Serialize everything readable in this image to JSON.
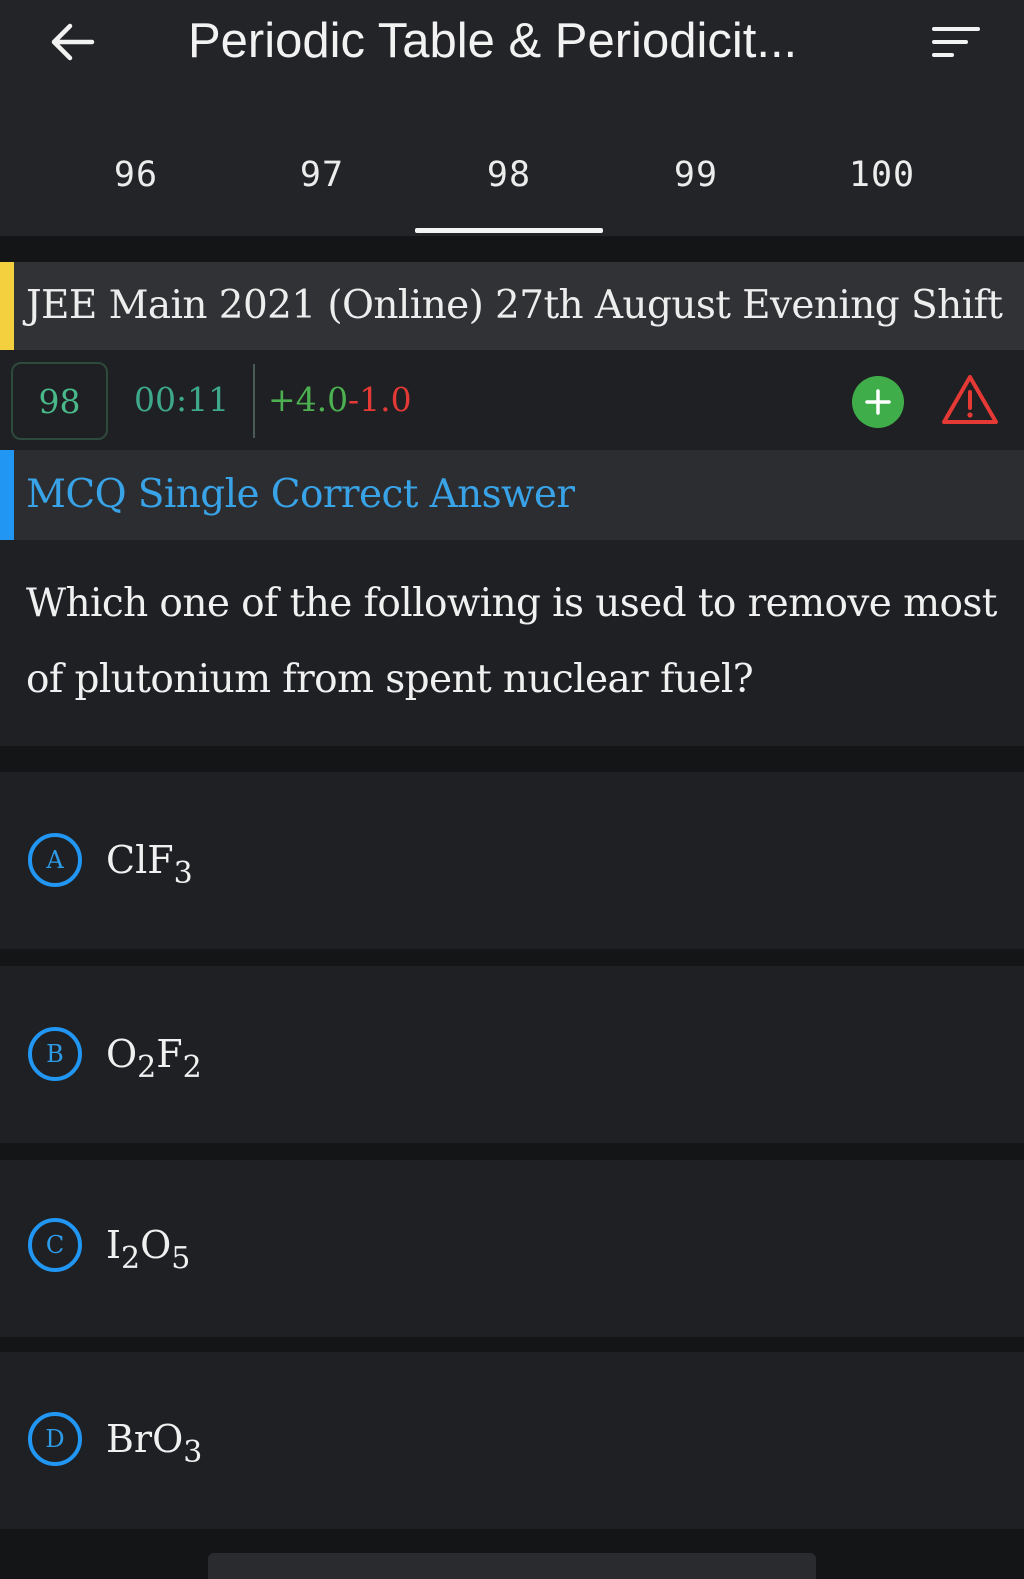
{
  "header": {
    "title": "Periodic Table & Periodicit...",
    "back_icon": "arrow-left-icon",
    "filter_icon": "filter-lines-icon"
  },
  "question_tabs": [
    {
      "label": "96"
    },
    {
      "label": "97"
    },
    {
      "label": "98",
      "active": true
    },
    {
      "label": "99"
    },
    {
      "label": "100"
    }
  ],
  "exam": {
    "label": "JEE Main 2021 (Online) 27th August Evening Shift",
    "accent_color": "#f4d03f"
  },
  "meta": {
    "question_number": "98",
    "timer": "00:11",
    "positive_marks": "+4.0",
    "negative_marks": "-1.0",
    "add_icon": "plus-circle-icon",
    "report_icon": "warning-triangle-icon"
  },
  "question_type": {
    "label": "MCQ Single Correct Answer",
    "accent_color": "#2196f3"
  },
  "question": {
    "text": "Which one of the following is used to remove most of plutonium from spent nuclear fuel?"
  },
  "options": [
    {
      "letter": "A",
      "parts": [
        "ClF",
        "3",
        ""
      ]
    },
    {
      "letter": "B",
      "parts": [
        "O",
        "2",
        "F",
        "2"
      ]
    },
    {
      "letter": "C",
      "parts": [
        "I",
        "2",
        "O",
        "5"
      ]
    },
    {
      "letter": "D",
      "parts": [
        "BrO",
        "3",
        ""
      ]
    }
  ]
}
